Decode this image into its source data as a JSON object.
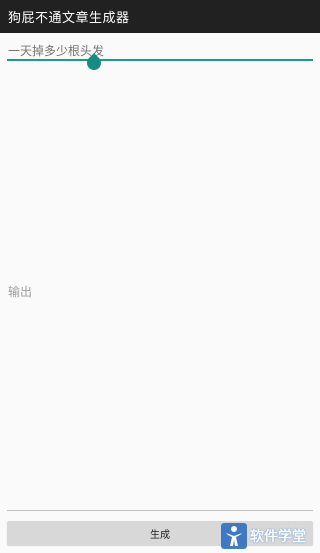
{
  "app": {
    "title": "狗屁不通文章生成器"
  },
  "input": {
    "placeholder": "一天掉多少根头发",
    "value": "",
    "accent_color": "#1a9e8c"
  },
  "output": {
    "text": "输出"
  },
  "actions": {
    "generate_label": "生成"
  },
  "watermark": {
    "text": "软件学堂",
    "logo_icon": "software-school-logo-icon"
  }
}
